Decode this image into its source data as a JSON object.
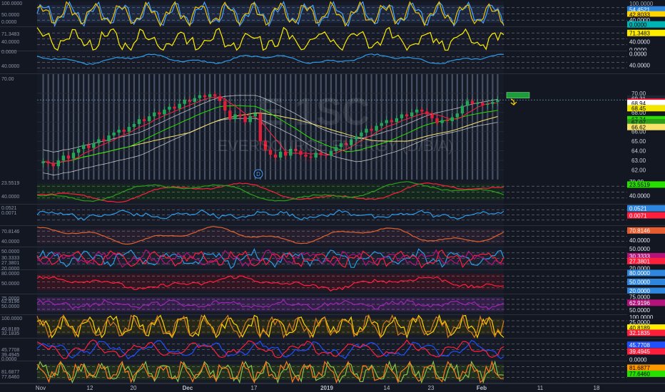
{
  "chart_data": {
    "type": "line",
    "title": "",
    "xlabel": "",
    "ylabel": "",
    "x_ticks": [
      "Nov",
      "12",
      "20",
      "Dec",
      "17",
      "2019",
      "14",
      "23",
      "Feb",
      "11",
      "18"
    ],
    "watermark": "E  1SC",
    "watermark_sub": "EVERSOURCE ENERGY (D/B/A)",
    "event_marker": "D",
    "price": {
      "ylim": [
        61,
        72
      ],
      "ticks": [
        "70.00",
        "69.00",
        "68.00",
        "67.00",
        "66.00",
        "65.00",
        "64.00",
        "63.00",
        "62.00"
      ],
      "axis_labels": [
        {
          "value": 69.31,
          "text": "69.31",
          "color": "#1e2633",
          "text_color": "#dfe6ee"
        },
        {
          "value": 69.03,
          "text": "69.03",
          "color": "#ff1f3d",
          "text_color": "#ffffff"
        },
        {
          "value": 68.94,
          "text": "68.94",
          "color": "#ffffff",
          "text_color": "#000000"
        },
        {
          "value": 68.45,
          "text": "68.45",
          "color": "#f2e600",
          "text_color": "#000000"
        },
        {
          "value": 67.34,
          "text": "67.34",
          "color": "#27e000",
          "text_color": "#000000"
        },
        {
          "value": 67.07,
          "text": "67.07",
          "color": "#2f9b1e",
          "text_color": "#000000"
        },
        {
          "value": 66.62,
          "text": "66.62",
          "color": "#f7e36a",
          "text_color": "#000000"
        }
      ],
      "closes": [
        62.9,
        62.7,
        62.4,
        63.0,
        63.5,
        63.2,
        63.8,
        64.2,
        64.6,
        64.3,
        64.8,
        65.2,
        65.0,
        65.6,
        65.9,
        66.2,
        66.0,
        66.5,
        66.8,
        67.3,
        67.1,
        67.6,
        68.0,
        67.8,
        68.3,
        68.6,
        68.4,
        68.9,
        69.3,
        69.1,
        69.5,
        69.8,
        69.6,
        69.9,
        69.7,
        69.2,
        68.2,
        67.3,
        67.8,
        67.6,
        67.0,
        67.6,
        67.9,
        65.0,
        64.1,
        63.6,
        63.3,
        63.9,
        63.5,
        64.2,
        64.0,
        63.6,
        63.4,
        63.3,
        63.8,
        63.6,
        63.5,
        64.0,
        64.4,
        64.8,
        64.6,
        65.2,
        65.5,
        65.9,
        66.3,
        66.1,
        66.6,
        66.9,
        67.2,
        67.0,
        67.4,
        67.8,
        67.6,
        68.0,
        68.3,
        68.1,
        67.8,
        67.4,
        66.9,
        67.2,
        67.1,
        67.5,
        67.9,
        68.7,
        69.2,
        68.9,
        69.0,
        68.8,
        68.9,
        69.1,
        69.3
      ],
      "ma_fast_color": "#ff1f3d",
      "ma_mid_color": "#27e000",
      "ma_slow_color": "#f7e36a",
      "bands_color": "#ffffff",
      "target_box_value": 69.8,
      "target_box_color": "#1e9c3c"
    },
    "left_scale_values": [
      "100.0000",
      "50.0000",
      "0.0000",
      "71.3483",
      "40.0000",
      "0.0000",
      "40.0000",
      "70.00",
      "23.5519",
      "40.0000",
      "0.0521",
      "0.0071",
      "70.8146",
      "40.0000",
      "50.0000",
      "30.3333",
      "27.3801",
      "20.0000",
      "80.0000",
      "50.0000",
      "75.0000",
      "62.9196",
      "50.0000",
      "100.0000",
      "40.8189",
      "32.1835",
      "45.7708",
      "39.4945",
      "0.0000",
      "81.6877",
      "77.6460"
    ],
    "panels": [
      {
        "id": "stoch",
        "labels": [
          {
            "text": "100.0000",
            "color": "#131722",
            "text_color": "#9aa3b2"
          },
          {
            "text": "54.4521",
            "color": "#2e86de",
            "text_color": "#ffffff"
          },
          {
            "text": "42.8033",
            "color": "#ffd400",
            "text_color": "#000000"
          },
          {
            "text": "40.0000",
            "color": "#131722",
            "text_color": "#dfe6ee"
          },
          {
            "text": "0.0000",
            "color": "#00b3b3",
            "text_color": "#000000"
          }
        ],
        "series": [
          {
            "color": "#4aa3ff"
          },
          {
            "color": "#f2c200"
          }
        ]
      },
      {
        "id": "rsi",
        "labels": [
          {
            "text": "71.3483",
            "color": "#ffee00",
            "text_color": "#000000"
          },
          {
            "text": "40.0000",
            "color": "#131722",
            "text_color": "#dfe6ee"
          },
          {
            "text": "0.0000",
            "color": "#131722",
            "text_color": "#dfe6ee"
          }
        ],
        "series": [
          {
            "color": "#ffee00"
          }
        ]
      },
      {
        "id": "cci",
        "labels": [
          {
            "text": "0.0000",
            "color": "#131722",
            "text_color": "#dfe6ee"
          },
          {
            "text": "40.0000",
            "color": "#131722",
            "text_color": "#dfe6ee"
          }
        ],
        "series": [
          {
            "color": "#2c9be8"
          }
        ]
      },
      {
        "id": "adx",
        "labels": [
          {
            "text": "70.00",
            "color": "#131722",
            "text_color": "#dfe6ee"
          },
          {
            "text": "23.5519",
            "color": "#27e000",
            "text_color": "#000000"
          },
          {
            "text": "40.0000",
            "color": "#131722",
            "text_color": "#dfe6ee"
          }
        ],
        "series": [
          {
            "color": "#ff1f3d"
          },
          {
            "color": "#2f9b1e"
          }
        ]
      },
      {
        "id": "macd",
        "labels": [
          {
            "text": "0.0521",
            "color": "#2e86de",
            "text_color": "#ffffff"
          },
          {
            "text": "0.0071",
            "color": "#ff1f3d",
            "text_color": "#ffffff"
          }
        ],
        "series": [
          {
            "color": "#2c9be8"
          }
        ]
      },
      {
        "id": "osc",
        "labels": [
          {
            "text": "70.8146",
            "color": "#e65c2e",
            "text_color": "#ffffff"
          },
          {
            "text": "40.0000",
            "color": "#131722",
            "text_color": "#dfe6ee"
          }
        ],
        "series": [
          {
            "color": "#e0622e"
          }
        ]
      },
      {
        "id": "dmi",
        "labels": [
          {
            "text": "50.0000",
            "color": "#131722",
            "text_color": "#dfe6ee"
          },
          {
            "text": "30.3333",
            "color": "#b3127a",
            "text_color": "#ffffff"
          },
          {
            "text": "27.3801",
            "color": "#ff1f3d",
            "text_color": "#ffffff"
          },
          {
            "text": "20.0000",
            "color": "#131722",
            "text_color": "#dfe6ee"
          }
        ],
        "series": [
          {
            "color": "#2c9be8"
          },
          {
            "color": "#ff1f3d"
          },
          {
            "color": "#b3127a"
          }
        ]
      },
      {
        "id": "mfi",
        "labels": [
          {
            "text": "80.0000",
            "color": "#2e86de",
            "text_color": "#ffffff"
          },
          {
            "text": "50.0000",
            "color": "#2e86de",
            "text_color": "#ffffff"
          },
          {
            "text": "20.0000",
            "color": "#2e86de",
            "text_color": "#ffffff"
          }
        ],
        "series": [
          {
            "color": "#ff1f3d"
          }
        ]
      },
      {
        "id": "wave",
        "labels": [
          {
            "text": "75.0000",
            "color": "#131722",
            "text_color": "#dfe6ee"
          },
          {
            "text": "62.9196",
            "color": "#b3127a",
            "text_color": "#ffffff"
          },
          {
            "text": "50.0000",
            "color": "#131722",
            "text_color": "#dfe6ee"
          }
        ],
        "series": [
          {
            "color": "#9c27b0"
          }
        ]
      },
      {
        "id": "stoch2",
        "labels": [
          {
            "text": "100.0000",
            "color": "#131722",
            "text_color": "#dfe6ee"
          },
          {
            "text": "25.0000",
            "color": "#131722",
            "text_color": "#dfe6ee"
          },
          {
            "text": "40.8189",
            "color": "#ffee00",
            "text_color": "#000000"
          },
          {
            "text": "32.1835",
            "color": "#ff1f3d",
            "text_color": "#ffffff"
          }
        ],
        "series": [
          {
            "color": "#ffd400"
          },
          {
            "color": "#d67a1e"
          }
        ]
      },
      {
        "id": "rvi",
        "labels": [
          {
            "text": "45.7708",
            "color": "#1f4fff",
            "text_color": "#ffffff"
          },
          {
            "text": "39.4945",
            "color": "#ff1f3d",
            "text_color": "#ffffff"
          },
          {
            "text": "0.0000",
            "color": "#131722",
            "text_color": "#dfe6ee"
          }
        ],
        "series": [
          {
            "color": "#1f4fff"
          },
          {
            "color": "#ff1f3d"
          }
        ]
      },
      {
        "id": "kst",
        "labels": [
          {
            "text": "81.6877",
            "color": "#ff9800",
            "text_color": "#000000"
          },
          {
            "text": "77.6460",
            "color": "#27e000",
            "text_color": "#000000"
          }
        ],
        "series": [
          {
            "color": "#8bc34a"
          },
          {
            "color": "#ff7a1a"
          }
        ]
      }
    ]
  }
}
